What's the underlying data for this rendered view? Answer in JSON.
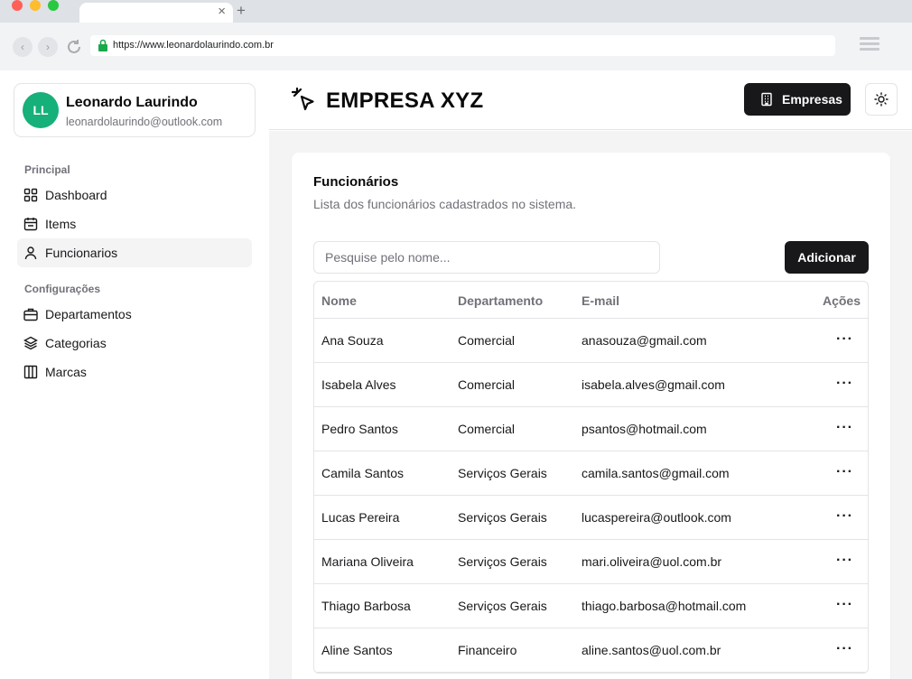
{
  "browser": {
    "url": "https://www.leonardolaurindo.com.br",
    "tab_close": "×",
    "new_tab": "+",
    "back": "‹",
    "forward": "›"
  },
  "profile": {
    "initials": "LL",
    "name": "Leonardo Laurindo",
    "email": "leonardolaurindo@outlook.com",
    "avatar_color": "#16b07a"
  },
  "sidebar": {
    "groups": [
      {
        "label": "Principal",
        "items": [
          {
            "label": "Dashboard",
            "icon": "grid-icon"
          },
          {
            "label": "Items",
            "icon": "calendar-icon"
          },
          {
            "label": "Funcionarios",
            "icon": "user-icon",
            "active": true
          }
        ]
      },
      {
        "label": "Configurações",
        "items": [
          {
            "label": "Departamentos",
            "icon": "briefcase-icon"
          },
          {
            "label": "Categorias",
            "icon": "layers-icon"
          },
          {
            "label": "Marcas",
            "icon": "columns-icon"
          }
        ]
      }
    ]
  },
  "header": {
    "title": "EMPRESA XYZ",
    "empresas_button": "Empresas",
    "theme_toggle_icon": "sun-icon"
  },
  "card": {
    "title": "Funcionários",
    "description": "Lista dos funcionários cadastrados no sistema.",
    "search_placeholder": "Pesquise pelo nome...",
    "add_button": "Adicionar"
  },
  "table": {
    "columns": [
      "Nome",
      "Departamento",
      "E-mail",
      "Ações"
    ],
    "rows": [
      {
        "nome": "Ana Souza",
        "departamento": "Comercial",
        "email": "anasouza@gmail.com"
      },
      {
        "nome": "Isabela Alves",
        "departamento": "Comercial",
        "email": "isabela.alves@gmail.com"
      },
      {
        "nome": "Pedro Santos",
        "departamento": "Comercial",
        "email": "psantos@hotmail.com"
      },
      {
        "nome": "Camila Santos",
        "departamento": "Serviços Gerais",
        "email": "camila.santos@gmail.com"
      },
      {
        "nome": "Lucas Pereira",
        "departamento": "Serviços Gerais",
        "email": "lucaspereira@outlook.com"
      },
      {
        "nome": "Mariana Oliveira",
        "departamento": "Serviços Gerais",
        "email": "mari.oliveira@uol.com.br"
      },
      {
        "nome": "Thiago Barbosa",
        "departamento": "Serviços Gerais",
        "email": "thiago.barbosa@hotmail.com"
      },
      {
        "nome": "Aline Santos",
        "departamento": "Financeiro",
        "email": "aline.santos@uol.com.br"
      }
    ],
    "row_action_label": "···"
  },
  "colors": {
    "primary": "#18181b",
    "muted_text": "#71717a",
    "border": "#e4e4e7",
    "content_bg": "#f4f4f5"
  }
}
